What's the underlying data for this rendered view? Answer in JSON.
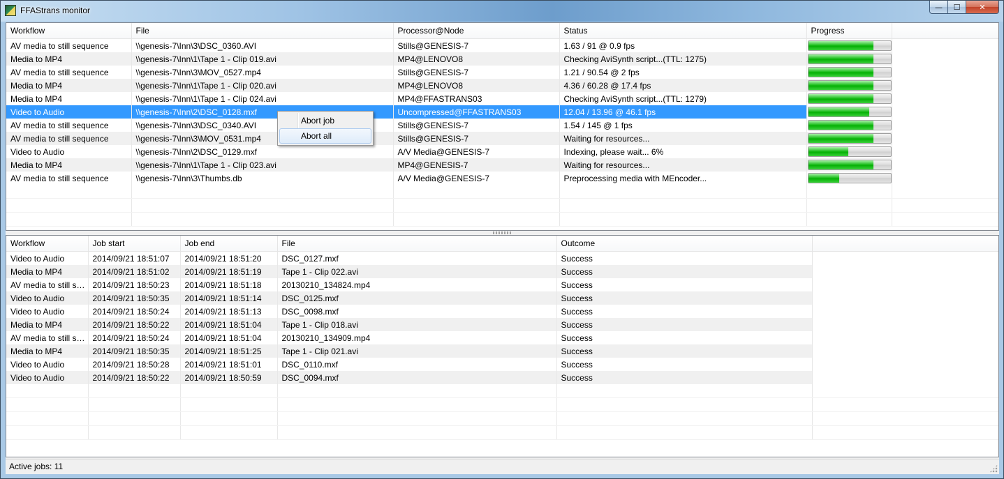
{
  "window": {
    "title": "FFAStrans monitor",
    "controls": {
      "minimize": "—",
      "maximize": "☐",
      "close": "✕"
    }
  },
  "active_jobs": {
    "columns": [
      "Workflow",
      "File",
      "Processor@Node",
      "Status",
      "Progress"
    ],
    "rows": [
      {
        "workflow": "AV media to still sequence",
        "file": "\\\\genesis-7\\Inn\\3\\DSC_0360.AVI",
        "processor": "Stills@GENESIS-7",
        "status": "1.63 / 91 @ 0.9 fps",
        "progress": 0.79
      },
      {
        "workflow": "Media to MP4",
        "file": "\\\\genesis-7\\Inn\\1\\Tape 1 - Clip 019.avi",
        "processor": "MP4@LENOVO8",
        "status": "Checking AviSynth script...(TTL: 1275)",
        "progress": 0.79
      },
      {
        "workflow": "AV media to still sequence",
        "file": "\\\\genesis-7\\Inn\\3\\MOV_0527.mp4",
        "processor": "Stills@GENESIS-7",
        "status": "1.21 / 90.54 @ 2 fps",
        "progress": 0.79
      },
      {
        "workflow": "Media to MP4",
        "file": "\\\\genesis-7\\Inn\\1\\Tape 1 - Clip 020.avi",
        "processor": "MP4@LENOVO8",
        "status": "4.36 / 60.28 @ 17.4 fps",
        "progress": 0.79
      },
      {
        "workflow": "Media to MP4",
        "file": "\\\\genesis-7\\Inn\\1\\Tape 1 - Clip 024.avi",
        "processor": "MP4@FFASTRANS03",
        "status": "Checking AviSynth script...(TTL: 1279)",
        "progress": 0.79
      },
      {
        "workflow": "Video to Audio",
        "file": "\\\\genesis-7\\Inn\\2\\DSC_0128.mxf",
        "processor": "Uncompressed@FFASTRANS03",
        "status": "12.04 / 13.96 @ 46.1 fps",
        "progress": 0.74,
        "selected": true
      },
      {
        "workflow": "AV media to still sequence",
        "file": "\\\\genesis-7\\Inn\\3\\DSC_0340.AVI",
        "processor": "Stills@GENESIS-7",
        "status": "1.54 / 145 @ 1 fps",
        "progress": 0.79
      },
      {
        "workflow": "AV media to still sequence",
        "file": "\\\\genesis-7\\Inn\\3\\MOV_0531.mp4",
        "processor": "Stills@GENESIS-7",
        "status": "Waiting for resources...",
        "progress": 0.79
      },
      {
        "workflow": "Video to Audio",
        "file": "\\\\genesis-7\\Inn\\2\\DSC_0129.mxf",
        "processor": "A/V Media@GENESIS-7",
        "status": "Indexing, please wait... 6%",
        "progress": 0.49
      },
      {
        "workflow": "Media to MP4",
        "file": "\\\\genesis-7\\Inn\\1\\Tape 1 - Clip 023.avi",
        "processor": "MP4@GENESIS-7",
        "status": "Waiting for resources...",
        "progress": 0.79
      },
      {
        "workflow": "AV media to still sequence",
        "file": "\\\\genesis-7\\Inn\\3\\Thumbs.db",
        "processor": "A/V Media@GENESIS-7",
        "status": "Preprocessing media with MEncoder...",
        "progress": 0.38
      }
    ]
  },
  "context_menu": {
    "items": [
      "Abort job",
      "Abort all"
    ]
  },
  "history": {
    "columns": [
      "Workflow",
      "Job start",
      "Job end",
      "File",
      "Outcome"
    ],
    "rows": [
      {
        "workflow": "Video to Audio",
        "start": "2014/09/21 18:51:07",
        "end": "2014/09/21 18:51:20",
        "file": "DSC_0127.mxf",
        "outcome": "Success"
      },
      {
        "workflow": "Media to MP4",
        "start": "2014/09/21 18:51:02",
        "end": "2014/09/21 18:51:19",
        "file": "Tape 1 - Clip 022.avi",
        "outcome": "Success"
      },
      {
        "workflow": "AV media to still se...",
        "start": "2014/09/21 18:50:23",
        "end": "2014/09/21 18:51:18",
        "file": "20130210_134824.mp4",
        "outcome": "Success"
      },
      {
        "workflow": "Video to Audio",
        "start": "2014/09/21 18:50:35",
        "end": "2014/09/21 18:51:14",
        "file": "DSC_0125.mxf",
        "outcome": "Success"
      },
      {
        "workflow": "Video to Audio",
        "start": "2014/09/21 18:50:24",
        "end": "2014/09/21 18:51:13",
        "file": "DSC_0098.mxf",
        "outcome": "Success"
      },
      {
        "workflow": "Media to MP4",
        "start": "2014/09/21 18:50:22",
        "end": "2014/09/21 18:51:04",
        "file": "Tape 1 - Clip 018.avi",
        "outcome": "Success"
      },
      {
        "workflow": "AV media to still se...",
        "start": "2014/09/21 18:50:24",
        "end": "2014/09/21 18:51:04",
        "file": "20130210_134909.mp4",
        "outcome": "Success"
      },
      {
        "workflow": "Media to MP4",
        "start": "2014/09/21 18:50:35",
        "end": "2014/09/21 18:51:25",
        "file": "Tape 1 - Clip 021.avi",
        "outcome": "Success"
      },
      {
        "workflow": "Video to Audio",
        "start": "2014/09/21 18:50:28",
        "end": "2014/09/21 18:51:01",
        "file": "DSC_0110.mxf",
        "outcome": "Success"
      },
      {
        "workflow": "Video to Audio",
        "start": "2014/09/21 18:50:22",
        "end": "2014/09/21 18:50:59",
        "file": "DSC_0094.mxf",
        "outcome": "Success"
      }
    ]
  },
  "statusbar": {
    "text": "Active jobs: 11"
  },
  "colors": {
    "selection": "#3399ff",
    "progress_fill": "#06b006",
    "alt_row": "#f0f0f0"
  }
}
